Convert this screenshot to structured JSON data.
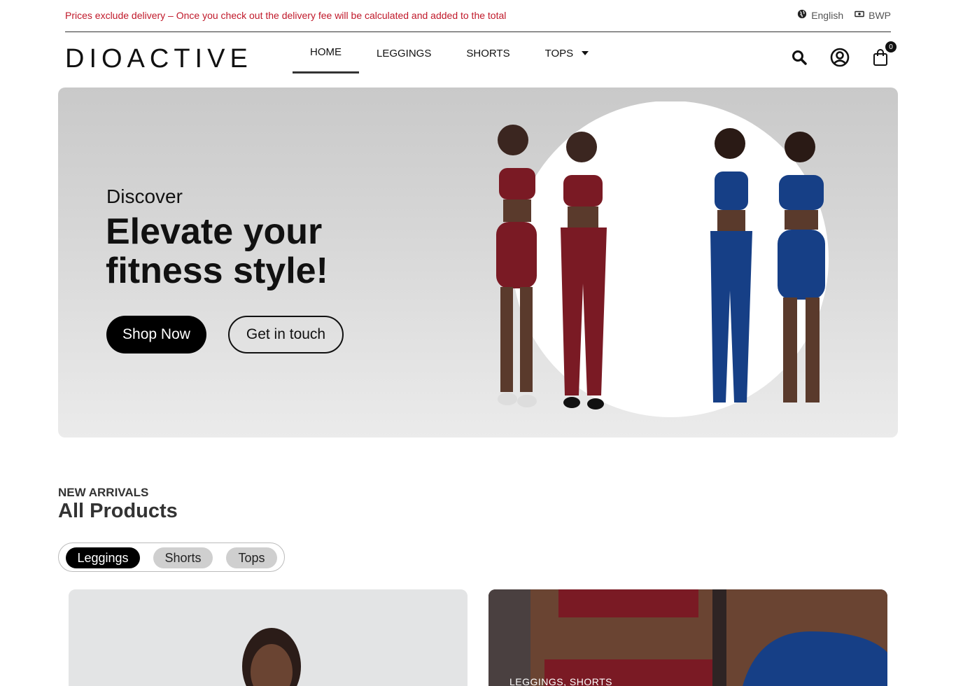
{
  "topbar": {
    "notice": "Prices exclude delivery – Once you check out the delivery fee will be calculated and added to the total",
    "language": "English",
    "currency": "BWP"
  },
  "header": {
    "logo": "DIOACTIVE",
    "nav": [
      {
        "label": "HOME",
        "active": true
      },
      {
        "label": "LEGGINGS"
      },
      {
        "label": "SHORTS"
      },
      {
        "label": "TOPS",
        "has_dropdown": true
      }
    ],
    "icons": [
      "search-icon",
      "account-icon",
      "cart-icon"
    ],
    "cart_count": "0"
  },
  "hero": {
    "eyebrow": "Discover",
    "title_line1": "Elevate your",
    "title_line2": "fitness style!",
    "primary_button": "Shop Now",
    "secondary_button": "Get in touch",
    "colors": {
      "burgundy": "#7a1a24",
      "navy": "#163f86"
    }
  },
  "products": {
    "eyebrow": "NEW ARRIVALS",
    "title": "All Products",
    "tabs": [
      {
        "label": "Leggings",
        "active": true
      },
      {
        "label": "Shorts"
      },
      {
        "label": "Tops"
      }
    ],
    "cards": [
      {
        "label": ""
      },
      {
        "label": "LEGGINGS, SHORTS"
      }
    ]
  }
}
